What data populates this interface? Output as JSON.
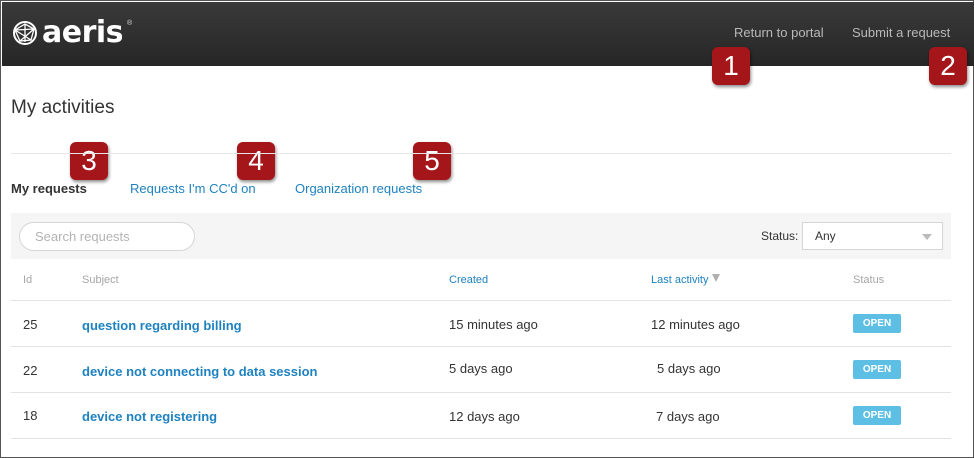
{
  "header": {
    "logo_text": "aeris",
    "return_link": "Return to portal",
    "submit_link": "Submit a request"
  },
  "callouts": [
    "1",
    "2",
    "3",
    "4",
    "5"
  ],
  "page": {
    "title": "My activities"
  },
  "tabs": [
    {
      "label": "My requests",
      "active": true
    },
    {
      "label": "Requests I'm CC'd on",
      "active": false
    },
    {
      "label": "Organization requests",
      "active": false
    }
  ],
  "filters": {
    "search_placeholder": "Search requests",
    "status_label": "Status:",
    "status_value": "Any"
  },
  "table": {
    "columns": [
      "Id",
      "Subject",
      "Created",
      "Last activity",
      "Status"
    ],
    "rows": [
      {
        "id": "25",
        "subject": "question regarding billing",
        "created": "15 minutes ago",
        "last_activity": "12 minutes ago",
        "status": "OPEN"
      },
      {
        "id": "22",
        "subject": "device not connecting to data session",
        "created": "5 days ago",
        "last_activity": "5 days ago",
        "status": "OPEN"
      },
      {
        "id": "18",
        "subject": "device not registering",
        "created": "12 days ago",
        "last_activity": "7 days ago",
        "status": "OPEN"
      }
    ]
  },
  "icons": {
    "logo": "globe-logo-icon",
    "sort": "sort-desc-icon",
    "dropdown": "caret-down-icon"
  },
  "colors": {
    "link": "#1f82c0",
    "badge": "#5ebfe4",
    "callout": "#a4161a",
    "header": "#2e2e2e"
  }
}
